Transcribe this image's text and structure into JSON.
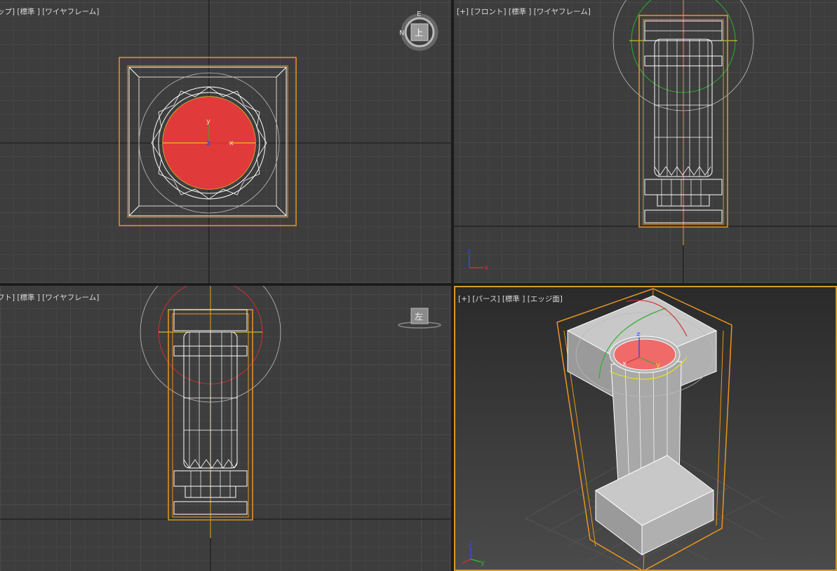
{
  "viewports": {
    "top": {
      "label": "ップ] [標準 ] [ワイヤフレーム]"
    },
    "front": {
      "label": "[+] [フロント] [標準 ] [ワイヤフレーム]"
    },
    "left": {
      "label": "フト] [標準 ] [ワイヤフレーム]"
    },
    "persp": {
      "label": "[+] [パース] [標準 ] [エッジ面]"
    }
  },
  "viewcube": {
    "top_face": "上",
    "left_face": "左",
    "compass_top": "E",
    "compass_left": "N"
  },
  "gizmo_axes": {
    "x": "x",
    "y": "y",
    "z": "z"
  },
  "colors": {
    "viewport_bg": "#3d3d3d",
    "selection_box": "#e8961e",
    "wire": "#ffffff",
    "selected_face": "#e03a3a",
    "gizmo_x": "#d03030",
    "gizmo_y": "#30b030",
    "gizmo_z": "#3050e0",
    "gizmo_yellow": "#e8e020",
    "active_border": "#d79a2a"
  }
}
